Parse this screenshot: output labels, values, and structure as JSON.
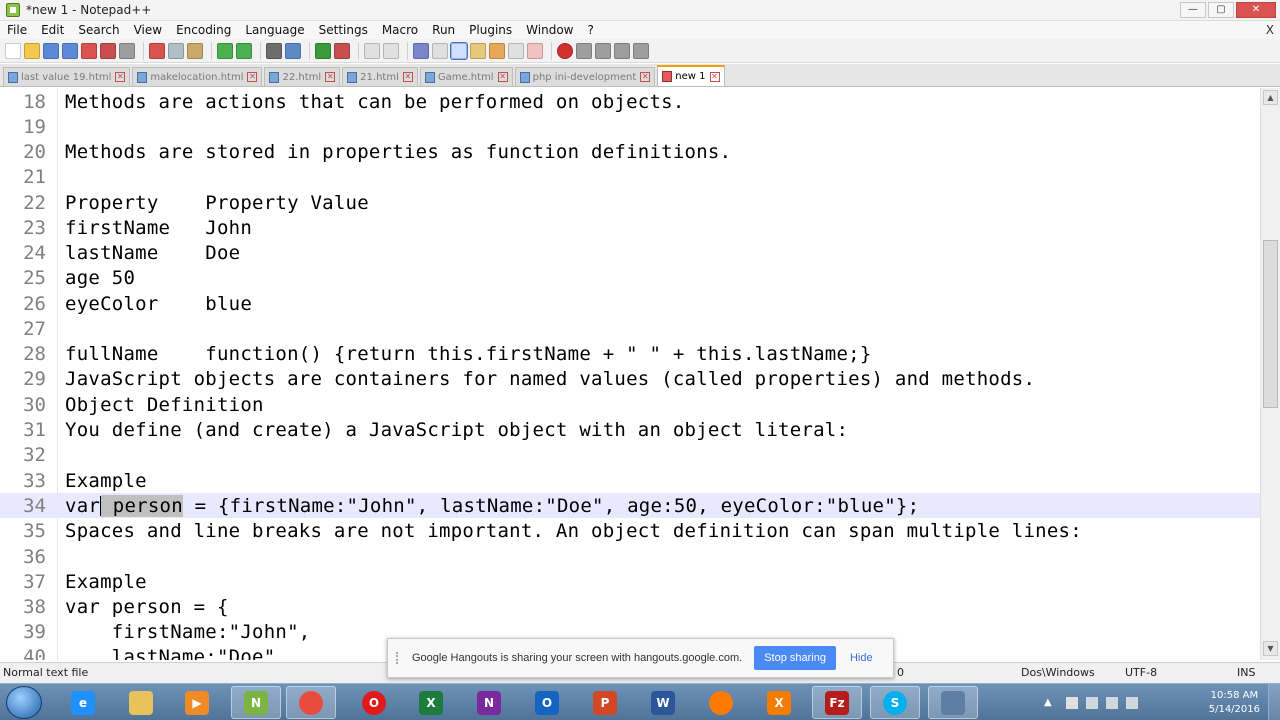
{
  "window": {
    "title": "*new 1 - Notepad++"
  },
  "menu": [
    "File",
    "Edit",
    "Search",
    "View",
    "Encoding",
    "Language",
    "Settings",
    "Macro",
    "Run",
    "Plugins",
    "Window",
    "?"
  ],
  "menu_close": "X",
  "tabs": [
    {
      "label": "last value 19.html",
      "active": false
    },
    {
      "label": "makelocation.html",
      "active": false
    },
    {
      "label": "22.html",
      "active": false
    },
    {
      "label": "21.html",
      "active": false
    },
    {
      "label": "Game.html",
      "active": false
    },
    {
      "label": "php ini-development",
      "active": false
    },
    {
      "label": "new 1",
      "active": true
    }
  ],
  "editor": {
    "current_line": 34,
    "lines": [
      {
        "num": "18",
        "text": "Methods are actions that can be performed on objects."
      },
      {
        "num": "19",
        "text": ""
      },
      {
        "num": "20",
        "text": "Methods are stored in properties as function definitions."
      },
      {
        "num": "21",
        "text": ""
      },
      {
        "num": "22",
        "text": "Property    Property Value"
      },
      {
        "num": "23",
        "text": "firstName   John"
      },
      {
        "num": "24",
        "text": "lastName    Doe"
      },
      {
        "num": "25",
        "text": "age 50"
      },
      {
        "num": "26",
        "text": "eyeColor    blue"
      },
      {
        "num": "27",
        "text": ""
      },
      {
        "num": "28",
        "text": "fullName    function() {return this.firstName + \" \" + this.lastName;}"
      },
      {
        "num": "29",
        "text": "JavaScript objects are containers for named values (called properties) and methods."
      },
      {
        "num": "30",
        "text": "Object Definition"
      },
      {
        "num": "31",
        "text": "You define (and create) a JavaScript object with an object literal:"
      },
      {
        "num": "32",
        "text": ""
      },
      {
        "num": "33",
        "text": "Example"
      },
      {
        "num": "34",
        "text": "var person = {firstName:\"John\", lastName:\"Doe\", age:50, eyeColor:\"blue\"};",
        "pre": "var",
        "selected": " person",
        "post": " = {firstName:\"John\", lastName:\"Doe\", age:50, eyeColor:\"blue\"};"
      },
      {
        "num": "35",
        "text": "Spaces and line breaks are not important. An object definition can span multiple lines:"
      },
      {
        "num": "36",
        "text": ""
      },
      {
        "num": "37",
        "text": "Example"
      },
      {
        "num": "38",
        "text": "var person = {"
      },
      {
        "num": "39",
        "text": "    firstName:\"John\","
      },
      {
        "num": "40",
        "text": "    lastName:\"Doe\","
      }
    ]
  },
  "status": {
    "file_type": "Normal text file",
    "position_tail": "0",
    "eol": "Dos\\Windows",
    "encoding": "UTF-8",
    "mode": "INS"
  },
  "hangouts": {
    "message": "Google Hangouts is sharing your screen with hangouts.google.com.",
    "stop_label": "Stop sharing",
    "hide_label": "Hide"
  },
  "taskbar": {
    "apps": [
      {
        "name": "internet-explorer-icon",
        "glyph": "e",
        "color": "#1e90ff"
      },
      {
        "name": "file-explorer-icon",
        "glyph": "",
        "color": "#e8c35a"
      },
      {
        "name": "media-player-icon",
        "glyph": "▶",
        "color": "#f08a24"
      },
      {
        "name": "notepadpp-icon",
        "glyph": "N",
        "color": "#7cb342"
      },
      {
        "name": "chrome-icon",
        "glyph": "",
        "color": "#e94b3c"
      },
      {
        "name": "opera-icon",
        "glyph": "O",
        "color": "#e01a1a"
      },
      {
        "name": "excel-icon",
        "glyph": "X",
        "color": "#1f7a3d"
      },
      {
        "name": "onenote-icon",
        "glyph": "N",
        "color": "#7a2a9c"
      },
      {
        "name": "outlook-icon",
        "glyph": "O",
        "color": "#1565c0"
      },
      {
        "name": "powerpoint-icon",
        "glyph": "P",
        "color": "#d24726"
      },
      {
        "name": "word-icon",
        "glyph": "W",
        "color": "#2b579a"
      },
      {
        "name": "firefox-icon",
        "glyph": "",
        "color": "#ff7a00"
      },
      {
        "name": "xampp-icon",
        "glyph": "X",
        "color": "#f57c00"
      },
      {
        "name": "filezilla-icon",
        "glyph": "Fz",
        "color": "#b71c1c"
      },
      {
        "name": "skype-icon",
        "glyph": "S",
        "color": "#00aff0"
      },
      {
        "name": "virtualbox-icon",
        "glyph": "",
        "color": "#5c7fa3"
      }
    ],
    "clock_time": "10:58 AM",
    "clock_date": "5/14/2016"
  }
}
